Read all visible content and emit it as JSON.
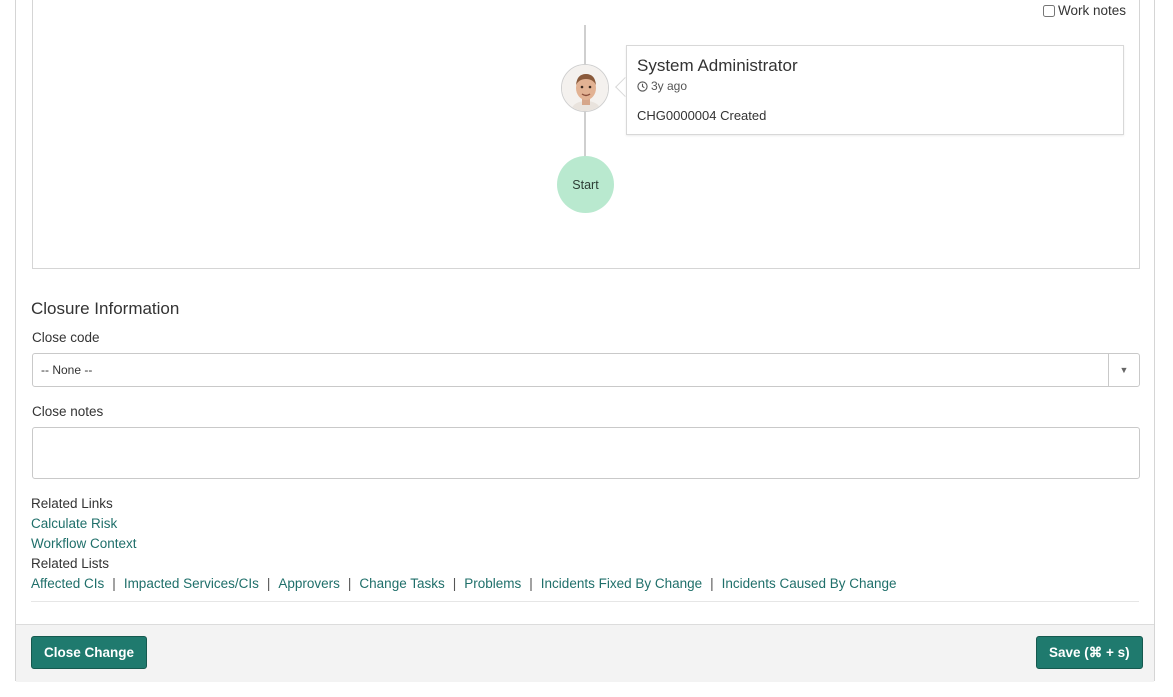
{
  "activity": {
    "work_notes_label": "Work notes",
    "entry": {
      "author": "System Administrator",
      "time": "3y ago",
      "text": "CHG0000004 Created"
    },
    "start_label": "Start"
  },
  "closure": {
    "title": "Closure Information",
    "close_code_label": "Close code",
    "close_code_value": "-- None --",
    "close_notes_label": "Close notes"
  },
  "related_links": {
    "heading": "Related Links",
    "items": [
      "Calculate Risk",
      "Workflow Context"
    ]
  },
  "related_lists": {
    "heading": "Related Lists",
    "items": [
      "Affected CIs",
      "Impacted Services/CIs",
      "Approvers",
      "Change Tasks",
      "Problems",
      "Incidents Fixed By Change",
      "Incidents Caused By Change"
    ]
  },
  "footer": {
    "close_change_label": "Close Change",
    "save_label": "Save (⌘ + s)"
  },
  "colors": {
    "primary": "#1f7a6e",
    "link": "#1f6f6a",
    "start_badge": "#b9e9cf"
  }
}
